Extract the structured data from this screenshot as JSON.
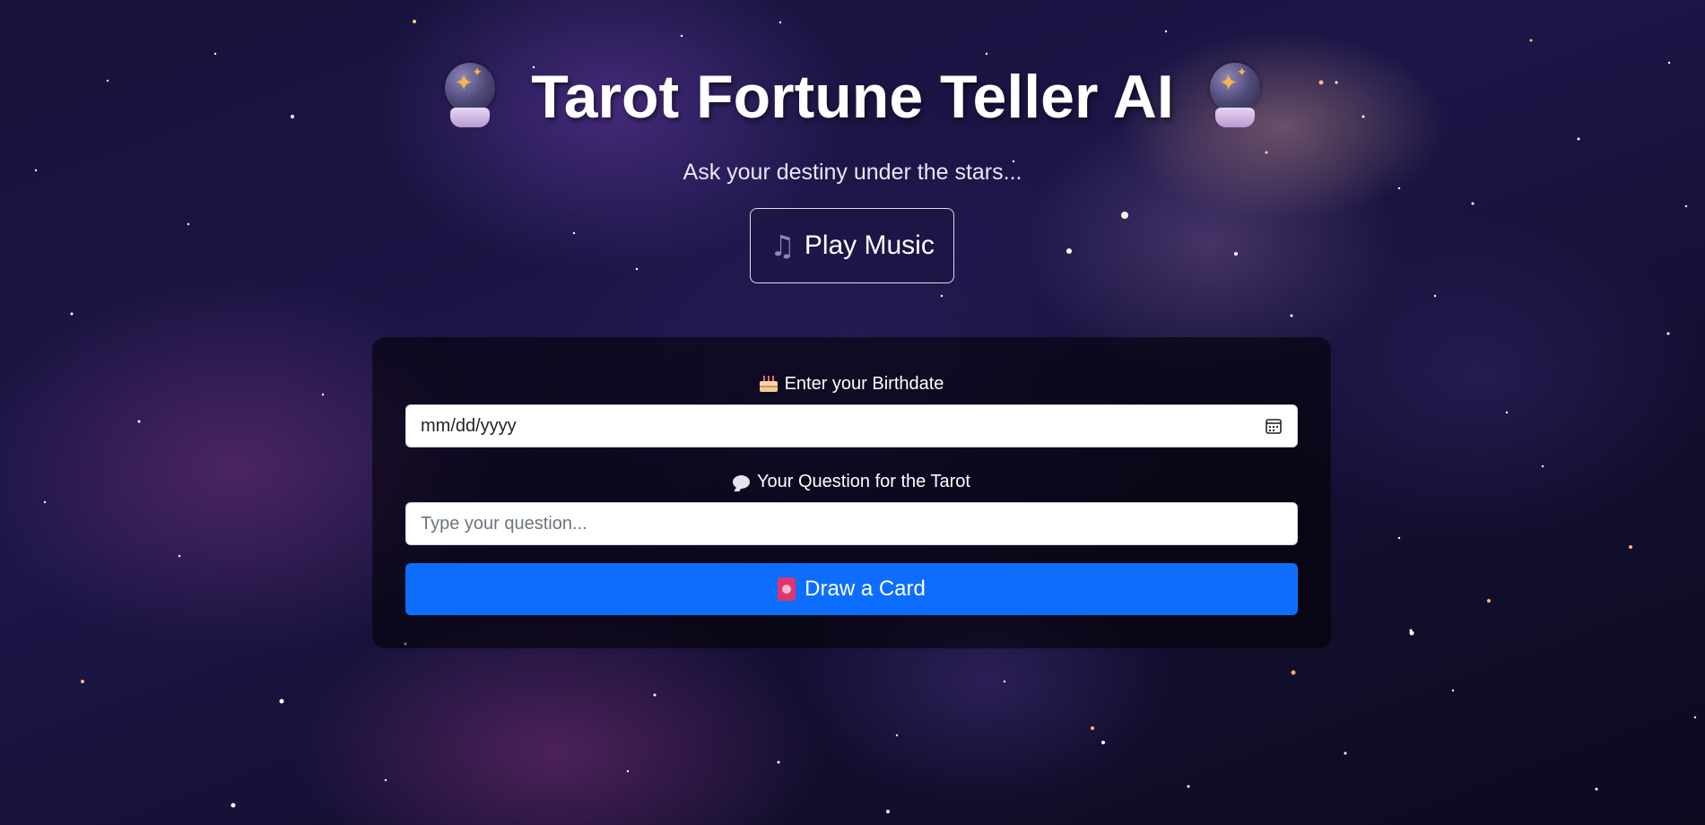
{
  "header": {
    "title": "Tarot Fortune Teller AI",
    "subtitle": "Ask your destiny under the stars...",
    "left_icon": "crystal-ball-icon",
    "right_icon": "crystal-ball-icon"
  },
  "music": {
    "icon": "musical-notes-icon",
    "label": "Play Music"
  },
  "form": {
    "birthdate": {
      "icon": "birthday-cake-icon",
      "label": "Enter your Birthdate",
      "value": "mm/dd/yyyy",
      "calendar_icon": "calendar-icon"
    },
    "question": {
      "icon": "speech-balloon-icon",
      "label": "Your Question for the Tarot",
      "placeholder": "Type your question..."
    },
    "submit": {
      "icon": "tarot-card-icon",
      "label": "Draw a Card"
    }
  },
  "colors": {
    "primary_button": "#0d6efd",
    "panel_background": "rgba(0,0,0,0.55)",
    "text": "#ffffff"
  }
}
